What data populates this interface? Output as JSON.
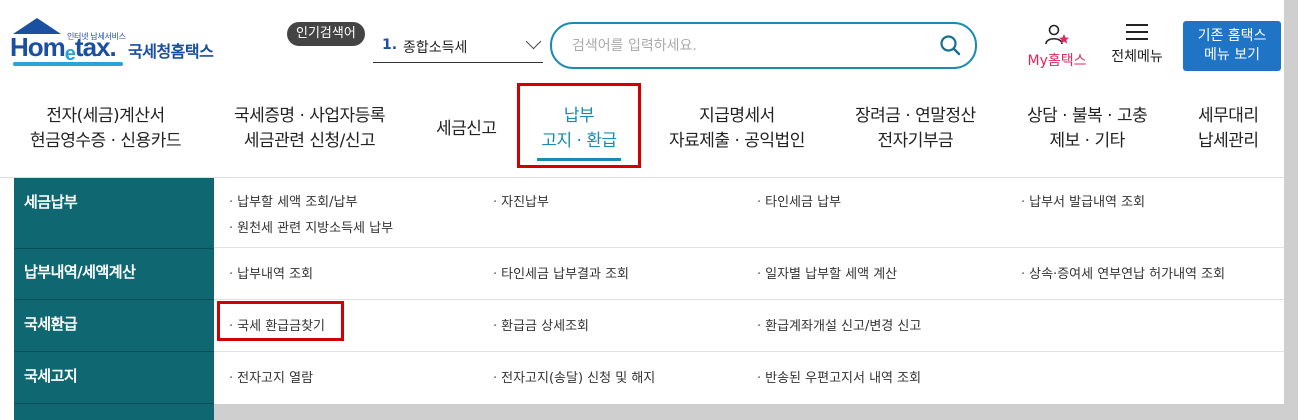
{
  "header": {
    "logo_small": "인터넷 납세서비스",
    "logo_main_1": "Hom",
    "logo_main_e": "e",
    "logo_main_2": "tax.",
    "logo_kr": "국세청홈택스",
    "popular_badge": "인기검색어",
    "popular_num": "1.",
    "popular_text": "종합소득세",
    "search_placeholder": "검색어를 입력하세요.",
    "myhome_label": "My홈택스",
    "menu_all_label": "전체메뉴",
    "old_btn_line1": "기존 홈택스",
    "old_btn_line2": "메뉴 보기"
  },
  "nav": [
    {
      "l1": "전자(세금)계산서",
      "l2": "현금영수증 · 신용카드"
    },
    {
      "l1": "국세증명 · 사업자등록",
      "l2": "세금관련 신청/신고"
    },
    {
      "l1": "세금신고",
      "l2": ""
    },
    {
      "l1": "납부",
      "l2": "고지 · 환급"
    },
    {
      "l1": "지급명세서",
      "l2": "자료제출 · 공익법인"
    },
    {
      "l1": "장려금 · 연말정산",
      "l2": "전자기부금"
    },
    {
      "l1": "상담 · 불복 · 고충",
      "l2": "제보 · 기타"
    },
    {
      "l1": "세무대리",
      "l2": "납세관리"
    }
  ],
  "categories": [
    "세금납부",
    "납부내역/세액계산",
    "국세환급",
    "국세고지"
  ],
  "links": {
    "r0": [
      "납부할 세액 조회/납부",
      "원천세 관련 지방소득세 납부",
      "자진납부",
      "타인세금 납부",
      "납부서 발급내역 조회"
    ],
    "r1": [
      "납부내역 조회",
      "타인세금 납부결과 조회",
      "일자별 납부할 세액 계산",
      "상속·증여세 연부연납 허가내역 조회"
    ],
    "r2": [
      "국세 환급금찾기",
      "환급금 상세조회",
      "환급계좌개설 신고/변경 신고"
    ],
    "r3": [
      "전자고지 열람",
      "전자고지(송달) 신청 및 해지",
      "반송된 우편고지서 내역 조회"
    ]
  },
  "colors": {
    "accent": "#1a8bb3",
    "sidebar": "#0f6771",
    "highlight": "#d40000",
    "button": "#1f74c6"
  }
}
